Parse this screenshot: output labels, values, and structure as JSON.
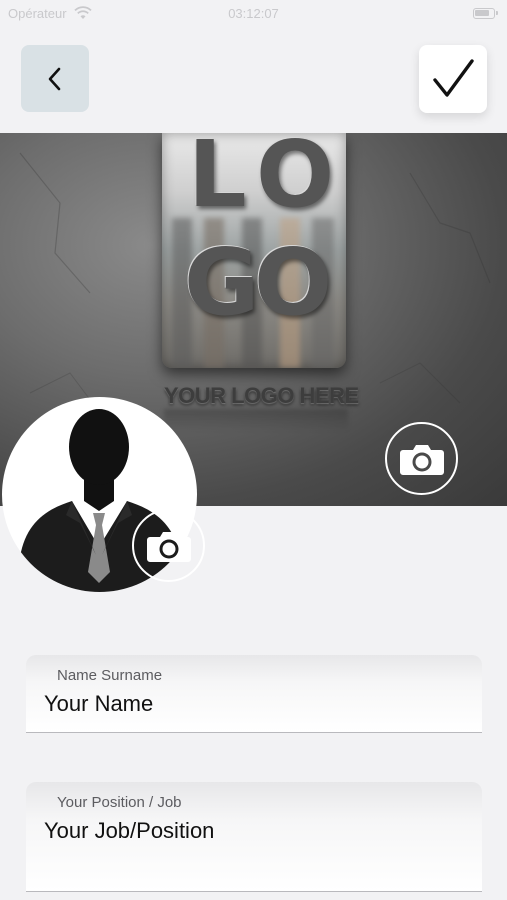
{
  "status_bar": {
    "carrier": "Opérateur",
    "time": "03:12:07"
  },
  "toolbar": {
    "back_icon": "chevron-left-icon",
    "confirm_icon": "checkmark-icon"
  },
  "cover": {
    "logo_letters": [
      "L",
      "O",
      "G",
      "O"
    ],
    "tagline": "YOUR LOGO HERE",
    "camera_icon": "camera-icon"
  },
  "avatar": {
    "icon": "person-silhouette-icon",
    "camera_icon": "camera-icon"
  },
  "form": {
    "name": {
      "label": "Name Surname",
      "value": "Your Name"
    },
    "job": {
      "label": "Your Position / Job",
      "value": "Your Job/Position"
    }
  },
  "colors": {
    "background": "#f2f2f4",
    "back_button_bg": "#d9e1e5",
    "confirm_button_bg": "#ffffff",
    "field_underline": "#b9b9bd"
  }
}
